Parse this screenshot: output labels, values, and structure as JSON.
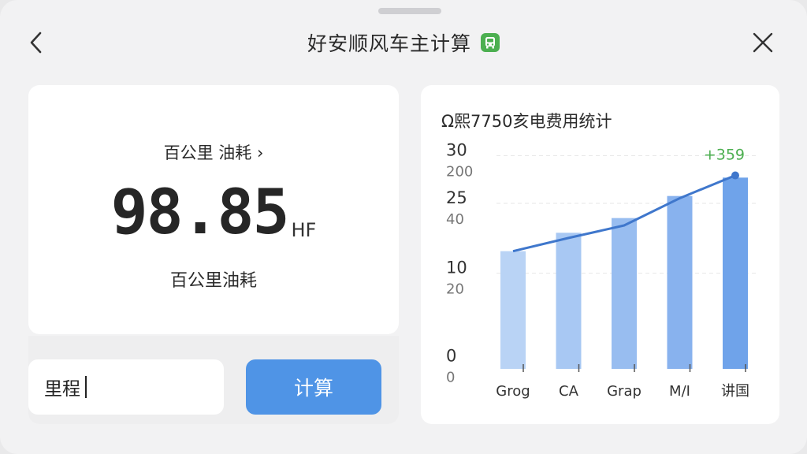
{
  "header": {
    "title": "好安顺风车主计算",
    "back_icon": "chevron-left-icon",
    "close_icon": "close-icon",
    "badge_icon": "bus-icon",
    "badge_color": "#4caf50"
  },
  "result": {
    "top_label": "百公里 油耗 ›",
    "value": "98.85",
    "unit": "HF",
    "bottom_label": "百公里油耗"
  },
  "form": {
    "mileage_label": "里程",
    "calculate_label": "计算",
    "button_color": "#4f94e6"
  },
  "chart_data": {
    "type": "bar",
    "title": "Ω熙7750亥电费用统计",
    "categories": [
      "Grog",
      "CA",
      "Grap",
      "M/I",
      "讲国"
    ],
    "values": [
      19,
      21.5,
      23.5,
      26.5,
      29
    ],
    "line_values": [
      19,
      20.8,
      22.5,
      26.2,
      29.3
    ],
    "annotation": "+359",
    "y_tick_labels": [
      {
        "primary": "30",
        "secondary": "200",
        "value": 32
      },
      {
        "primary": "25",
        "secondary": "40",
        "value": 25.5
      },
      {
        "primary": "10",
        "secondary": "20",
        "value": 16
      },
      {
        "primary": "0",
        "secondary": "0",
        "value": 4
      }
    ],
    "ylim": [
      3,
      33
    ],
    "grid": true,
    "colors": {
      "bars": [
        "#b9d3f5",
        "#a8c8f3",
        "#98bdf0",
        "#88b2ee",
        "#6fa3ea"
      ],
      "line": "#3f77cc",
      "annotation": "#4caf50"
    }
  }
}
